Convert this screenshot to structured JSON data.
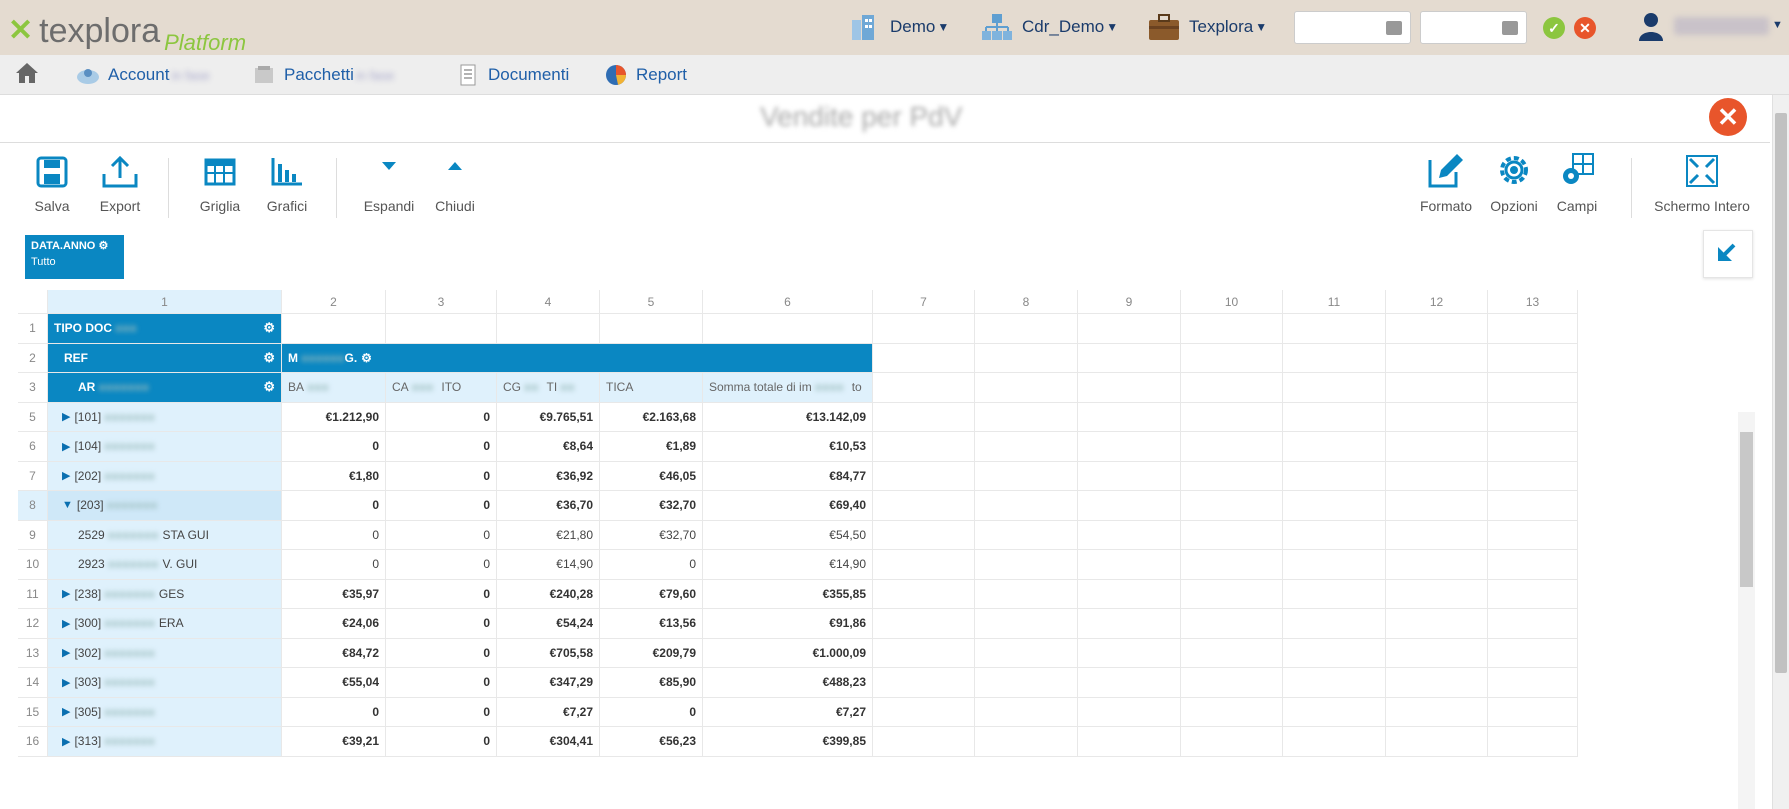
{
  "app": {
    "logo_name": "texplora",
    "logo_sub": "Platform"
  },
  "topbar": {
    "demo": "Demo",
    "cdr": "Cdr_Demo",
    "company": "Texplora"
  },
  "nav": {
    "account": "Account",
    "pacchetti": "Pacchetti",
    "documenti": "Documenti",
    "report": "Report"
  },
  "report": {
    "title": "Vendite per PdV"
  },
  "toolbar": {
    "salva": "Salva",
    "export": "Export",
    "griglia": "Griglia",
    "grafici": "Grafici",
    "espandi": "Espandi",
    "chiudi": "Chiudi",
    "formato": "Formato",
    "opzioni": "Opzioni",
    "campi": "Campi",
    "schermo": "Schermo Intero"
  },
  "filter": {
    "field": "DATA.ANNO",
    "value": "Tutto"
  },
  "grid": {
    "col_numbers": [
      "1",
      "2",
      "3",
      "4",
      "5",
      "6",
      "7",
      "8",
      "9",
      "10",
      "11",
      "12",
      "13"
    ],
    "header_row1": "TIPO DOC",
    "header_row2a": "REF",
    "header_row2b": "M",
    "header_row2b_end": "G.",
    "header_row3a": "AR",
    "measures": [
      "BA",
      "CA",
      "ITO",
      "CG",
      "TI",
      "TICA",
      "Somma totale di im",
      "to"
    ],
    "rows": [
      {
        "n": "5",
        "label": "[101]",
        "tail": "",
        "expand": "collapsed",
        "bold": true,
        "v": [
          "€1.212,90",
          "0",
          "€9.765,51",
          "€2.163,68",
          "€13.142,09"
        ]
      },
      {
        "n": "6",
        "label": "[104]",
        "tail": "",
        "expand": "collapsed",
        "bold": true,
        "v": [
          "0",
          "0",
          "€8,64",
          "€1,89",
          "€10,53"
        ]
      },
      {
        "n": "7",
        "label": "[202]",
        "tail": "",
        "expand": "collapsed",
        "bold": true,
        "v": [
          "€1,80",
          "0",
          "€36,92",
          "€46,05",
          "€84,77"
        ]
      },
      {
        "n": "8",
        "label": "[203]",
        "tail": "",
        "expand": "expanded",
        "bold": true,
        "v": [
          "0",
          "0",
          "€36,70",
          "€32,70",
          "€69,40"
        ]
      },
      {
        "n": "9",
        "label": "2529",
        "tail": "STA GUI",
        "expand": "none",
        "bold": false,
        "v": [
          "0",
          "0",
          "€21,80",
          "€32,70",
          "€54,50"
        ]
      },
      {
        "n": "10",
        "label": "2923",
        "tail": "V. GUI",
        "expand": "none",
        "bold": false,
        "v": [
          "0",
          "0",
          "€14,90",
          "0",
          "€14,90"
        ]
      },
      {
        "n": "11",
        "label": "[238]",
        "tail": "GES",
        "expand": "collapsed",
        "bold": true,
        "v": [
          "€35,97",
          "0",
          "€240,28",
          "€79,60",
          "€355,85"
        ]
      },
      {
        "n": "12",
        "label": "[300]",
        "tail": "ERA",
        "expand": "collapsed",
        "bold": true,
        "v": [
          "€24,06",
          "0",
          "€54,24",
          "€13,56",
          "€91,86"
        ]
      },
      {
        "n": "13",
        "label": "[302]",
        "tail": "",
        "expand": "collapsed",
        "bold": true,
        "v": [
          "€84,72",
          "0",
          "€705,58",
          "€209,79",
          "€1.000,09"
        ]
      },
      {
        "n": "14",
        "label": "[303]",
        "tail": "",
        "expand": "collapsed",
        "bold": true,
        "v": [
          "€55,04",
          "0",
          "€347,29",
          "€85,90",
          "€488,23"
        ]
      },
      {
        "n": "15",
        "label": "[305]",
        "tail": "",
        "expand": "collapsed",
        "bold": true,
        "v": [
          "0",
          "0",
          "€7,27",
          "0",
          "€7,27"
        ]
      },
      {
        "n": "16",
        "label": "[313]",
        "tail": "",
        "expand": "collapsed",
        "bold": true,
        "v": [
          "€39,21",
          "0",
          "€304,41",
          "€56,23",
          "€399,85"
        ]
      }
    ]
  }
}
